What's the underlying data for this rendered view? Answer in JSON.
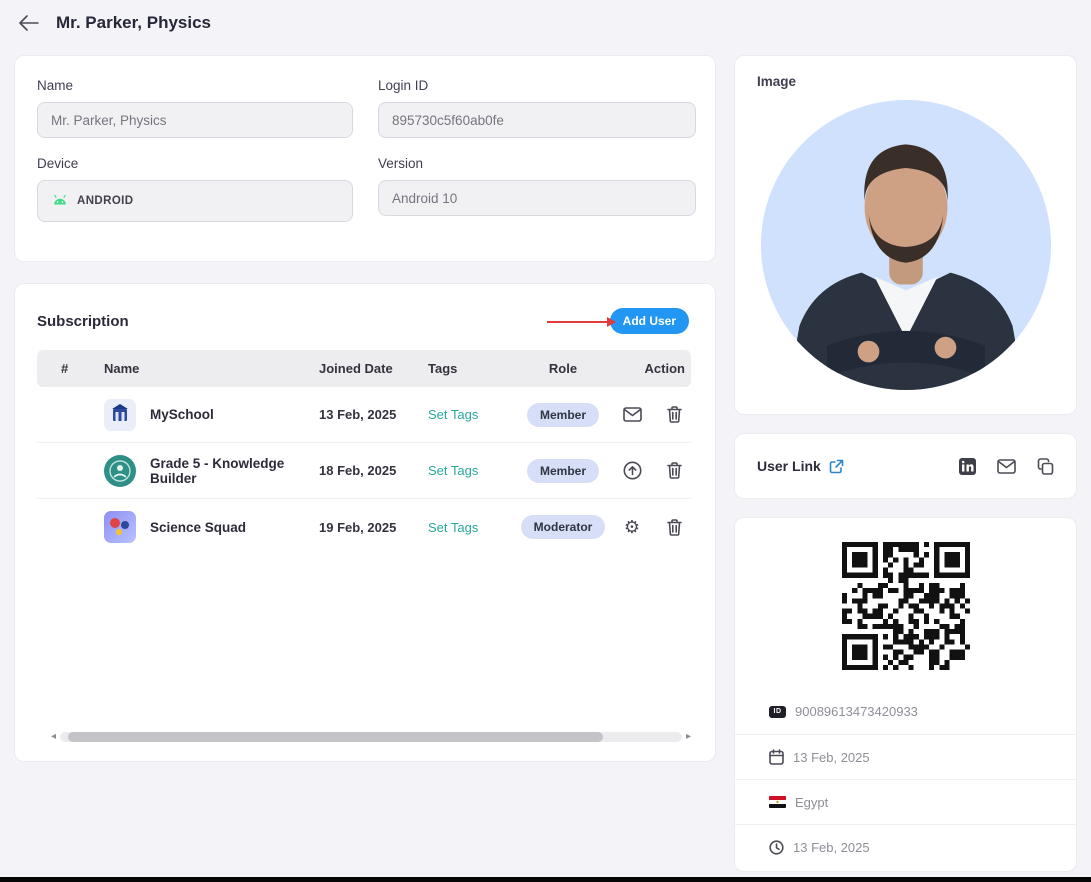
{
  "header": {
    "title": "Mr. Parker, Physics"
  },
  "profile": {
    "name_label": "Name",
    "name_value": "Mr. Parker, Physics",
    "login_label": "Login ID",
    "login_value": "895730c5f60ab0fe",
    "device_label": "Device",
    "device_value": "ANDROID",
    "version_label": "Version",
    "version_value": "Android 10"
  },
  "subscription": {
    "title": "Subscription",
    "add_user_label": "Add User",
    "headers": [
      "#",
      "Name",
      "Joined Date",
      "Tags",
      "Role",
      "Action"
    ],
    "rows": [
      {
        "name": "MySchool",
        "joined_date": "13 Feb, 2025",
        "tags": "Set Tags",
        "role": "Member",
        "action_icons": [
          "mail-icon",
          "delete-icon"
        ]
      },
      {
        "name": "Grade 5 - Knowledge Builder",
        "joined_date": "18 Feb, 2025",
        "tags": "Set Tags",
        "role": "Member",
        "action_icons": [
          "upload-circle-icon",
          "delete-icon"
        ]
      },
      {
        "name": "Science Squad",
        "joined_date": "19 Feb, 2025",
        "tags": "Set Tags",
        "role": "Moderator",
        "action_icons": [
          "settings-icon",
          "delete-icon"
        ]
      }
    ]
  },
  "image_card": {
    "label": "Image"
  },
  "user_link_card": {
    "label": "User Link",
    "icons": [
      "linkedin-icon",
      "mail-icon",
      "copy-icon"
    ]
  },
  "info_card": {
    "user_id": "90089613473420933",
    "joined_date": "13 Feb, 2025",
    "country": "Egypt",
    "last_seen": "13 Feb, 2025"
  },
  "icons": {
    "scroll_left": "◂",
    "scroll_right": "▸",
    "gear": "⚙"
  },
  "colors": {
    "accent_blue": "#2196f3",
    "teal": "#2aa79b",
    "badge_bg": "#d7def7",
    "annotation_red": "#e23b3b",
    "android_green": "#3ddc84"
  }
}
